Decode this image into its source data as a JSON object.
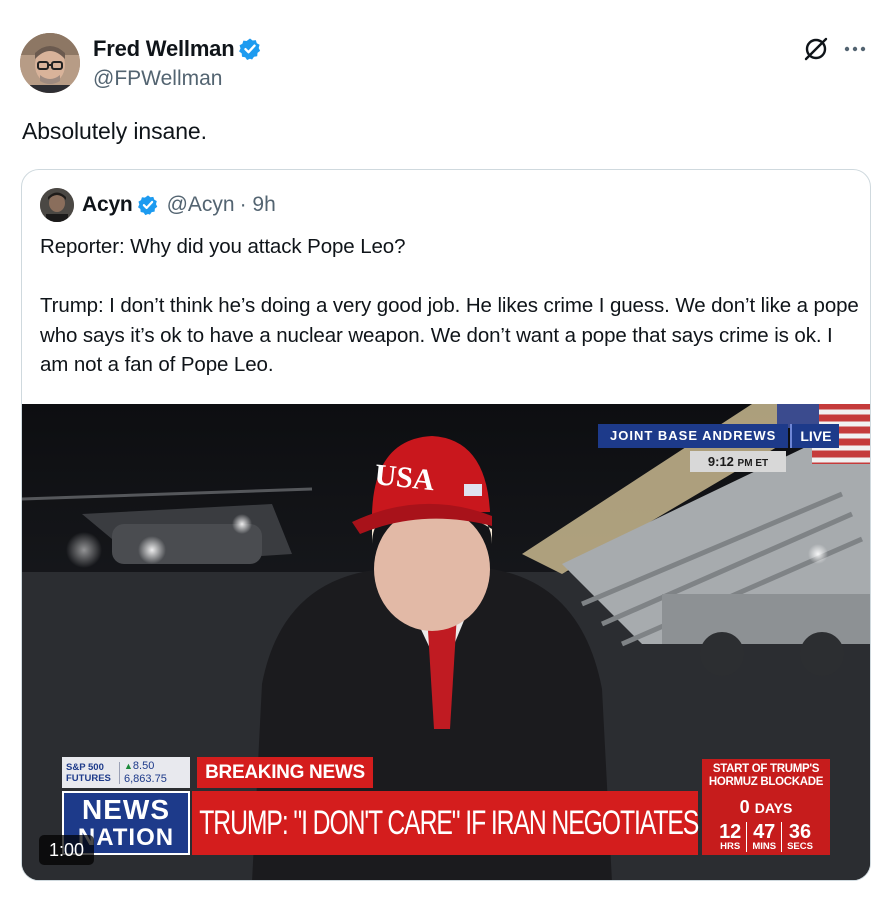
{
  "tweet": {
    "author_name": "Fred Wellman",
    "author_handle": "@FPWellman",
    "text": "Absolutely insane."
  },
  "quoted": {
    "author_name": "Acyn",
    "author_handle": "@Acyn",
    "time": "· 9h",
    "paragraph_1": "Reporter: Why did you attack Pope Leo?",
    "paragraph_2": "Trump: I don’t think he’s doing a very good job. He likes crime I guess. We don’t like a pope who says it’s ok to have a nuclear weapon. We don’t want a pope that says crime is ok. I am not a fan of Pope Leo."
  },
  "video": {
    "duration": "1:00",
    "location": "JOINT BASE ANDREWS",
    "live": "LIVE",
    "time": "9:12",
    "time_suffix": "PM ET",
    "hat_text": "USA",
    "ticker": {
      "label_line1": "S&P 500",
      "label_line2": "FUTURES",
      "change": "8.50",
      "value": "6,863.75"
    },
    "breaking": "BREAKING NEWS",
    "network_line1": "NEWS",
    "network_line2": "NATION",
    "headline": "TRUMP: \"I DON'T CARE\" IF IRAN NEGOTIATES",
    "countdown": {
      "title_line1": "START OF TRUMP'S",
      "title_line2": "HORMUZ BLOCKADE",
      "days_value": "0",
      "days_label": "DAYS",
      "hours": "12",
      "hours_label": "HRS",
      "mins": "47",
      "mins_label": "MINS",
      "secs": "36",
      "secs_label": "SECS"
    }
  },
  "colors": {
    "verified": "#1d9bf0",
    "secondary_text": "#536471",
    "news_red": "#d41d1d",
    "news_blue": "#1d3a8a"
  },
  "icons": [
    "verified-badge-icon",
    "grok-icon",
    "more-icon"
  ]
}
